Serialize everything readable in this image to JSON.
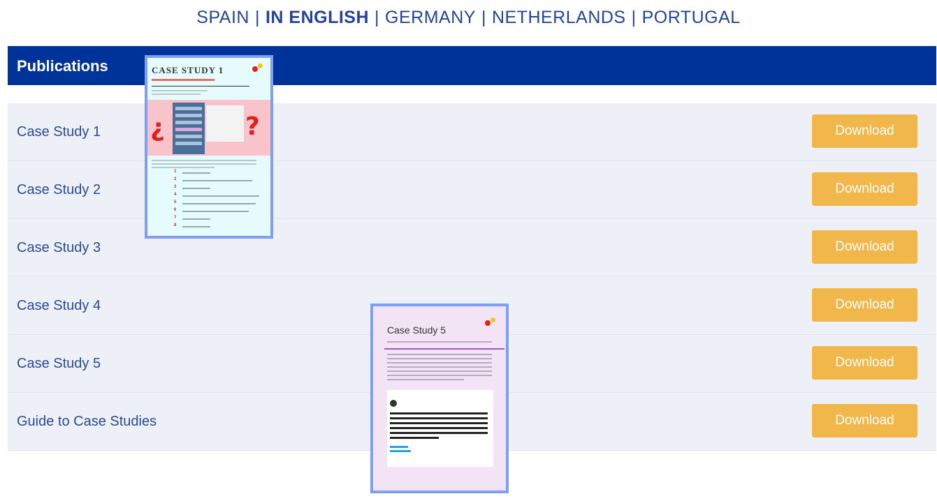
{
  "languages": [
    {
      "label": "SPAIN",
      "active": false
    },
    {
      "label": "IN ENGLISH",
      "active": true
    },
    {
      "label": "GERMANY",
      "active": false
    },
    {
      "label": "NETHERLANDS",
      "active": false
    },
    {
      "label": "PORTUGAL",
      "active": false
    }
  ],
  "separator": "|",
  "header": {
    "title": "Publications"
  },
  "rows": [
    {
      "label": "Case Study 1",
      "button": "Download"
    },
    {
      "label": "Case Study 2",
      "button": "Download"
    },
    {
      "label": "Case Study 3",
      "button": "Download"
    },
    {
      "label": "Case Study 4",
      "button": "Download"
    },
    {
      "label": "Case Study 5",
      "button": "Download"
    },
    {
      "label": "Guide to Case Studies",
      "button": "Download"
    }
  ],
  "thumbnails": {
    "case1_title": "CASE STUDY 1",
    "case5_title": "Case Study 5"
  },
  "colors": {
    "accent": "#003399",
    "button": "#f1b74a",
    "link_text": "#2a4a95",
    "row_bg": "#eef0f7"
  }
}
